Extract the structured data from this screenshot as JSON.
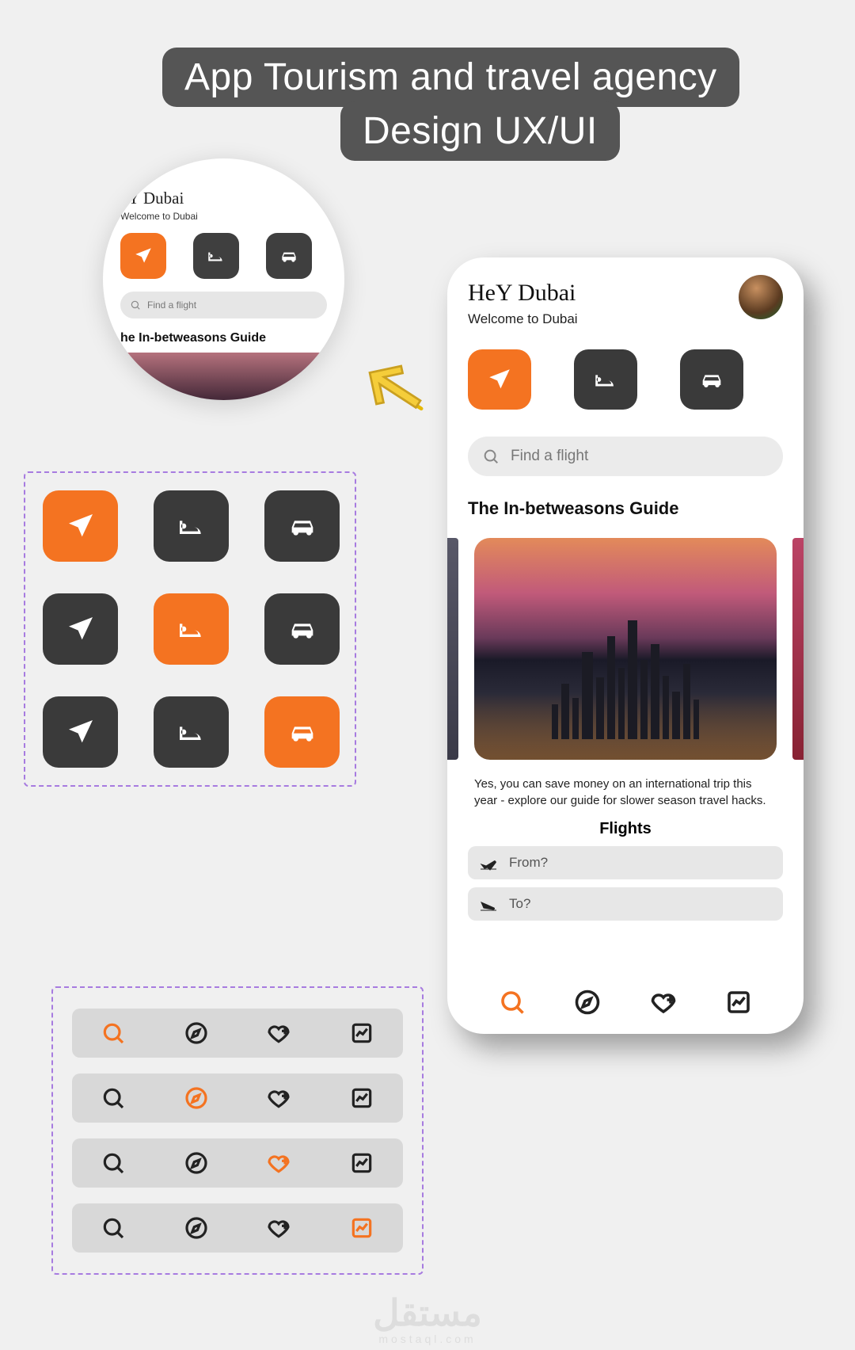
{
  "title": {
    "line1": "App Tourism and travel agency",
    "line2": "Design UX/UI"
  },
  "zoom": {
    "title": "eY Dubai",
    "subtitle": "Welcome to Dubai",
    "search_placeholder": "Find a flight",
    "heading": "he In-betweasons Guide"
  },
  "icon_grid": [
    [
      "plane",
      "bed",
      "car"
    ],
    [
      "plane",
      "bed",
      "car"
    ],
    [
      "plane",
      "bed",
      "car"
    ]
  ],
  "icon_grid_active": [
    [
      0,
      0
    ],
    [
      1,
      1
    ],
    [
      2,
      2
    ]
  ],
  "nav_variants_active_index": [
    0,
    1,
    2,
    3
  ],
  "phone": {
    "title": "HeY Dubai",
    "subtitle": "Welcome to Dubai",
    "search_placeholder": "Find a flight",
    "heading": "The In-betweasons Guide",
    "card_caption": "Yes, you can save money on an international trip this year - explore our guide for slower season travel hacks.",
    "flights_title": "Flights",
    "from_placeholder": "From?",
    "to_placeholder": "To?"
  },
  "watermark": "مستقل",
  "watermark_sub": "mostaql.com"
}
